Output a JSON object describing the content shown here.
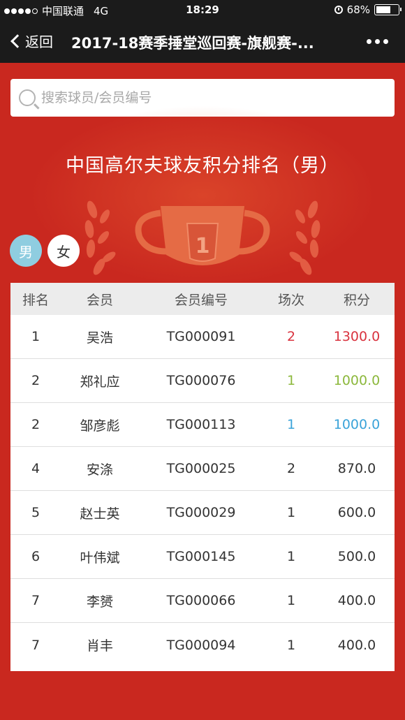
{
  "status_bar": {
    "carrier": "中国联通",
    "network": "4G",
    "time": "18:29",
    "battery": "68%",
    "battery_level": 0.68,
    "icons": [
      "signal-dots-icon",
      "alarm-icon",
      "battery-icon"
    ]
  },
  "nav": {
    "back_label": "返回",
    "title": "2017-18赛季捶堂巡回赛-旗舰赛-...",
    "icons": [
      "chevron-left-icon",
      "more-dots-icon"
    ]
  },
  "search": {
    "placeholder": "搜索球员/会员编号",
    "value": "",
    "icon": "search-icon"
  },
  "banner": {
    "title": "中国高尔夫球友积分排名（男）",
    "trophy_badge": "1",
    "icons": [
      "trophy-icon",
      "laurel-wreath-icon"
    ]
  },
  "gender_toggle": {
    "male": "男",
    "female": "女",
    "selected": "男"
  },
  "table": {
    "headers": [
      "排名",
      "会员",
      "会员编号",
      "场次",
      "积分"
    ],
    "rows": [
      {
        "rank": "1",
        "name": "吴浩",
        "member_id": "TG000091",
        "rounds": "2",
        "points": "1300.0",
        "color": "#d9333f"
      },
      {
        "rank": "2",
        "name": "郑礼应",
        "member_id": "TG000076",
        "rounds": "1",
        "points": "1000.0",
        "color": "#8cb83c"
      },
      {
        "rank": "2",
        "name": "邹彦彪",
        "member_id": "TG000113",
        "rounds": "1",
        "points": "1000.0",
        "color": "#3aa3d9"
      },
      {
        "rank": "4",
        "name": "安涤",
        "member_id": "TG000025",
        "rounds": "2",
        "points": "870.0",
        "color": "#333333"
      },
      {
        "rank": "5",
        "name": "赵士英",
        "member_id": "TG000029",
        "rounds": "1",
        "points": "600.0",
        "color": "#333333"
      },
      {
        "rank": "6",
        "name": "叶伟斌",
        "member_id": "TG000145",
        "rounds": "1",
        "points": "500.0",
        "color": "#333333"
      },
      {
        "rank": "7",
        "name": "李赟",
        "member_id": "TG000066",
        "rounds": "1",
        "points": "400.0",
        "color": "#333333"
      },
      {
        "rank": "7",
        "name": "肖丰",
        "member_id": "TG000094",
        "rounds": "1",
        "points": "400.0",
        "color": "#333333"
      }
    ]
  },
  "colors": {
    "background": "#c9281f",
    "header_bar": "#1b1b1b",
    "male_toggle": "#8fcde0",
    "gold": "#d9333f",
    "silver": "#8cb83c",
    "bronze": "#3aa3d9"
  }
}
